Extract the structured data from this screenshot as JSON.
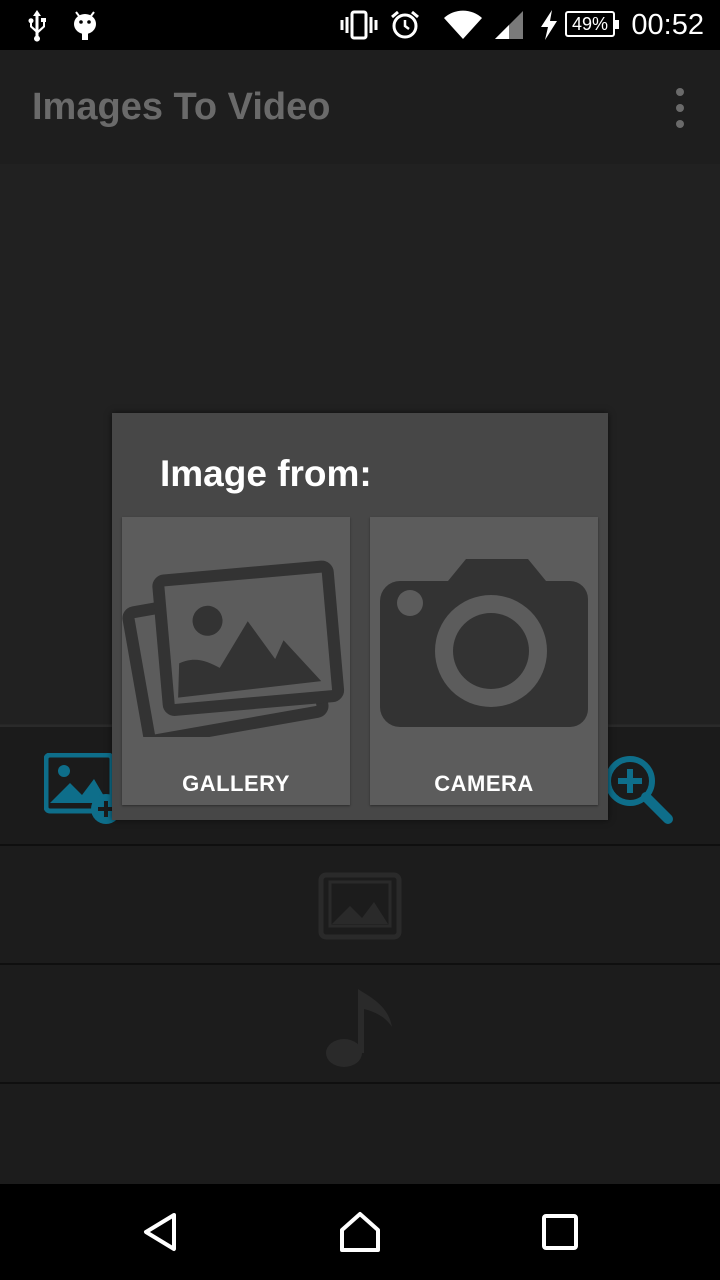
{
  "status_bar": {
    "battery_percent": "49%",
    "time": "00:52",
    "icons": [
      "usb-icon",
      "android-debug-icon",
      "vibrate-icon",
      "alarm-icon",
      "wifi-icon",
      "signal-icon",
      "charging-icon",
      "battery-icon"
    ]
  },
  "app_bar": {
    "title": "Images To Video",
    "menu_icon": "overflow-menu-icon"
  },
  "toolbar": {
    "icons": [
      "add-image-icon",
      "zoom-in-icon"
    ],
    "accent_color": "#0e6e8a"
  },
  "rows": {
    "icons": [
      "image-placeholder-icon",
      "music-note-icon"
    ]
  },
  "dialog": {
    "title": "Image from:",
    "options": [
      {
        "label": "GALLERY",
        "icon": "gallery-icon"
      },
      {
        "label": "CAMERA",
        "icon": "camera-icon"
      }
    ]
  },
  "nav_bar": {
    "icons": [
      "back-icon",
      "home-icon",
      "recents-icon"
    ]
  }
}
